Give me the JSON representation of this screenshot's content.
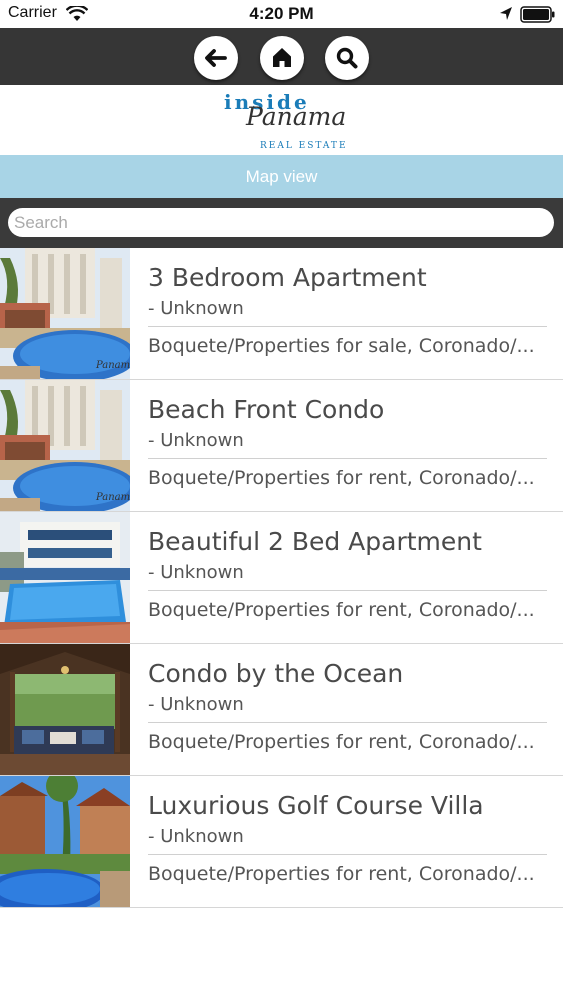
{
  "status_bar": {
    "carrier": "Carrier",
    "time": "4:20 PM",
    "icons": [
      "wifi-icon",
      "location-arrow-icon",
      "battery-icon"
    ]
  },
  "nav": {
    "buttons": [
      {
        "name": "back",
        "icon": "arrow-left-icon"
      },
      {
        "name": "home",
        "icon": "home-icon"
      },
      {
        "name": "search",
        "icon": "magnifier-icon"
      }
    ],
    "background": "#363636"
  },
  "logo": {
    "line1": "inside",
    "line2": "Panama",
    "line3": "REAL ESTATE"
  },
  "map_view": {
    "label": "Map view",
    "background": "#a8d4e6"
  },
  "search": {
    "placeholder": "Search",
    "value": ""
  },
  "listings": [
    {
      "title": "3 Bedroom Apartment",
      "subtitle": "- Unknown",
      "category": "Boquete/Properties for sale, Coronado/...",
      "thumbnail": "pool-highrise-image"
    },
    {
      "title": "Beach Front Condo",
      "subtitle": "- Unknown",
      "category": "Boquete/Properties for rent, Coronado/...",
      "thumbnail": "pool-highrise-image"
    },
    {
      "title": "Beautiful 2 Bed Apartment",
      "subtitle": "- Unknown",
      "category": "Boquete/Properties for rent, Coronado/...",
      "thumbnail": "pool-building-image"
    },
    {
      "title": "Condo by the Ocean",
      "subtitle": "- Unknown",
      "category": "Boquete/Properties for rent, Coronado/...",
      "thumbnail": "patio-image"
    },
    {
      "title": "Luxurious Golf Course Villa",
      "subtitle": "- Unknown",
      "category": "Boquete/Properties for rent, Coronado/...",
      "thumbnail": "villa-pool-image"
    }
  ]
}
